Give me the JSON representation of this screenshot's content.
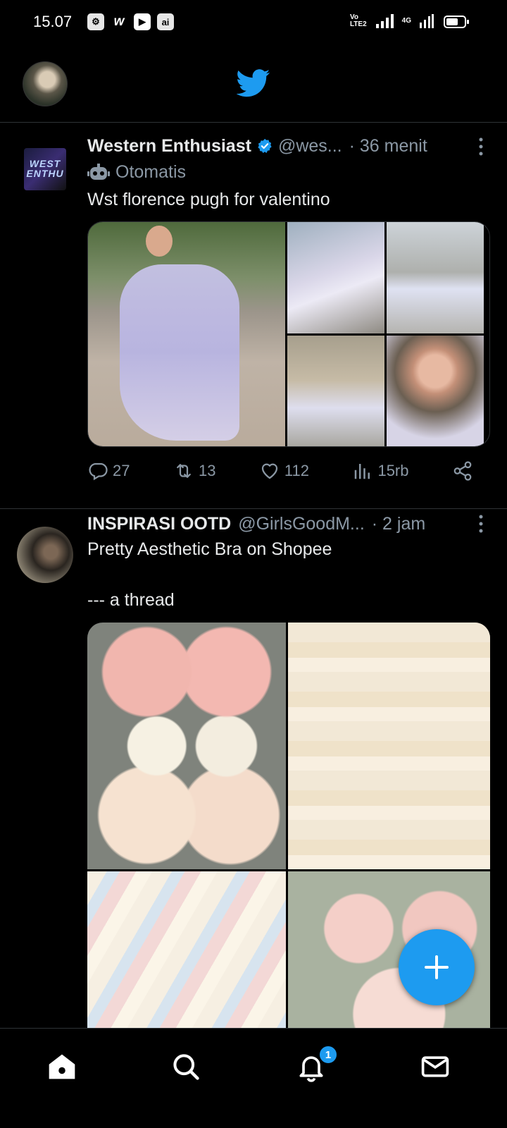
{
  "status_bar": {
    "time": "15.07",
    "app_icons": [
      "settings-app-icon",
      "w-app-icon",
      "youtube-app-icon",
      "ai-app-icon"
    ],
    "net_volte": "Vo\nLTE2",
    "net_4g": "4G",
    "battery_level": 0.65
  },
  "header": {
    "avatar_icon": "profile-avatar",
    "logo_icon": "twitter-bird-icon",
    "logo_color": "#1d9bf0"
  },
  "tweets": [
    {
      "name": "Western Enthusiast",
      "handle": "@wes...",
      "time": "· 36 menit",
      "verified": true,
      "automated_label": "Otomatis",
      "avatar_text": "WEST\nENTHU",
      "text": "Wst florence pugh for valentino",
      "replies": "27",
      "retweets": "13",
      "likes": "112",
      "views": "15rb"
    },
    {
      "name": "INSPIRASI OOTD",
      "handle": "@GirlsGoodM...",
      "time": "· 2 jam",
      "text": "Pretty Aesthetic Bra on Shopee\n\n--- a thread"
    }
  ],
  "fab": {
    "icon": "compose-plus-icon"
  },
  "bottom_nav": {
    "items": [
      "home-icon",
      "search-icon",
      "notifications-icon",
      "messages-icon"
    ],
    "notification_badge": "1"
  },
  "colors": {
    "accent": "#1d9bf0",
    "background": "#000000",
    "secondary_text": "#8b98a5"
  }
}
